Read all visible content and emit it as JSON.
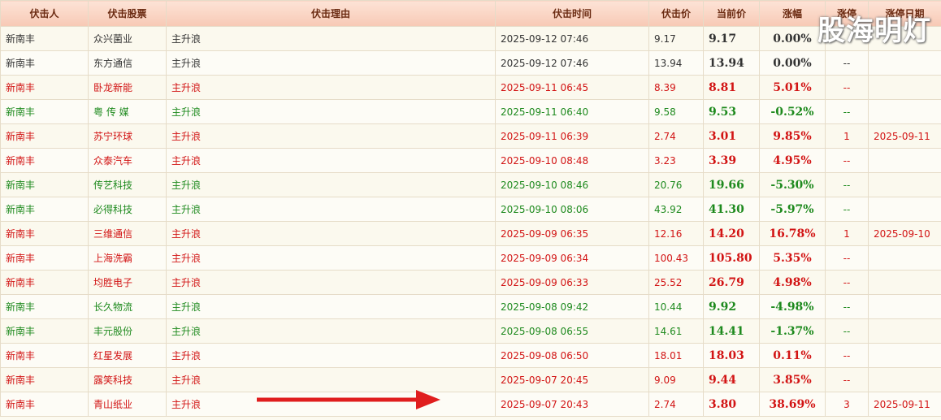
{
  "headers": [
    "伏击人",
    "伏击股票",
    "伏击理由",
    "伏击时间",
    "伏击价",
    "当前价",
    "涨幅",
    "涨停",
    "涨停日期"
  ],
  "watermark": "股海明灯",
  "colors": {
    "up": "#d21414",
    "down": "#1e8a1e",
    "flat": "#333333",
    "header_text": "#6b2b12",
    "arrow": "#e01e1e"
  },
  "rows": [
    {
      "trend": "flat",
      "person": "新南丰",
      "stock": "众兴菌业",
      "reason": "主升浪",
      "time": "2025-09-12 07:46",
      "buy": "9.17",
      "cur": "9.17",
      "pct": "0.00%",
      "limit": "",
      "limit_date": ""
    },
    {
      "trend": "flat",
      "person": "新南丰",
      "stock": "东方通信",
      "reason": "主升浪",
      "time": "2025-09-12 07:46",
      "buy": "13.94",
      "cur": "13.94",
      "pct": "0.00%",
      "limit": "--",
      "limit_date": ""
    },
    {
      "trend": "up",
      "person": "新南丰",
      "stock": "卧龙新能",
      "reason": "主升浪",
      "time": "2025-09-11 06:45",
      "buy": "8.39",
      "cur": "8.81",
      "pct": "5.01%",
      "limit": "--",
      "limit_date": ""
    },
    {
      "trend": "down",
      "person": "新南丰",
      "stock": "粤 传 媒",
      "reason": "主升浪",
      "time": "2025-09-11 06:40",
      "buy": "9.58",
      "cur": "9.53",
      "pct": "-0.52%",
      "limit": "--",
      "limit_date": ""
    },
    {
      "trend": "up",
      "person": "新南丰",
      "stock": "苏宁环球",
      "reason": "主升浪",
      "time": "2025-09-11 06:39",
      "buy": "2.74",
      "cur": "3.01",
      "pct": "9.85%",
      "limit": "1",
      "limit_date": "2025-09-11"
    },
    {
      "trend": "up",
      "person": "新南丰",
      "stock": "众泰汽车",
      "reason": "主升浪",
      "time": "2025-09-10 08:48",
      "buy": "3.23",
      "cur": "3.39",
      "pct": "4.95%",
      "limit": "--",
      "limit_date": ""
    },
    {
      "trend": "down",
      "person": "新南丰",
      "stock": "传艺科技",
      "reason": "主升浪",
      "time": "2025-09-10 08:46",
      "buy": "20.76",
      "cur": "19.66",
      "pct": "-5.30%",
      "limit": "--",
      "limit_date": ""
    },
    {
      "trend": "down",
      "person": "新南丰",
      "stock": "必得科技",
      "reason": "主升浪",
      "time": "2025-09-10 08:06",
      "buy": "43.92",
      "cur": "41.30",
      "pct": "-5.97%",
      "limit": "--",
      "limit_date": ""
    },
    {
      "trend": "up",
      "person": "新南丰",
      "stock": "三维通信",
      "reason": "主升浪",
      "time": "2025-09-09 06:35",
      "buy": "12.16",
      "cur": "14.20",
      "pct": "16.78%",
      "limit": "1",
      "limit_date": "2025-09-10"
    },
    {
      "trend": "up",
      "person": "新南丰",
      "stock": "上海洗霸",
      "reason": "主升浪",
      "time": "2025-09-09 06:34",
      "buy": "100.43",
      "cur": "105.80",
      "pct": "5.35%",
      "limit": "--",
      "limit_date": ""
    },
    {
      "trend": "up",
      "person": "新南丰",
      "stock": "均胜电子",
      "reason": "主升浪",
      "time": "2025-09-09 06:33",
      "buy": "25.52",
      "cur": "26.79",
      "pct": "4.98%",
      "limit": "--",
      "limit_date": ""
    },
    {
      "trend": "down",
      "person": "新南丰",
      "stock": "长久物流",
      "reason": "主升浪",
      "time": "2025-09-08 09:42",
      "buy": "10.44",
      "cur": "9.92",
      "pct": "-4.98%",
      "limit": "--",
      "limit_date": ""
    },
    {
      "trend": "down",
      "person": "新南丰",
      "stock": "丰元股份",
      "reason": "主升浪",
      "time": "2025-09-08 06:55",
      "buy": "14.61",
      "cur": "14.41",
      "pct": "-1.37%",
      "limit": "--",
      "limit_date": ""
    },
    {
      "trend": "up",
      "person": "新南丰",
      "stock": "红星发展",
      "reason": "主升浪",
      "time": "2025-09-08 06:50",
      "buy": "18.01",
      "cur": "18.03",
      "pct": "0.11%",
      "limit": "--",
      "limit_date": ""
    },
    {
      "trend": "up",
      "person": "新南丰",
      "stock": "露笑科技",
      "reason": "主升浪",
      "time": "2025-09-07 20:45",
      "buy": "9.09",
      "cur": "9.44",
      "pct": "3.85%",
      "limit": "--",
      "limit_date": ""
    },
    {
      "trend": "up",
      "person": "新南丰",
      "stock": "青山纸业",
      "reason": "主升浪",
      "time": "2025-09-07 20:43",
      "buy": "2.74",
      "cur": "3.80",
      "pct": "38.69%",
      "limit": "3",
      "limit_date": "2025-09-11"
    }
  ]
}
